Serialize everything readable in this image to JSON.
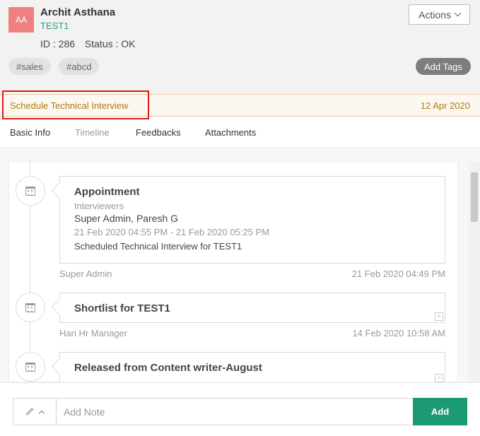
{
  "candidate": {
    "avatar_initials": "AA",
    "name": "Archit Asthana",
    "job": "TEST1",
    "id_text": "ID : 286",
    "status_text": "Status : OK"
  },
  "header": {
    "actions_label": "Actions",
    "tags": [
      "#sales",
      "#abcd"
    ],
    "add_tags_label": "Add Tags"
  },
  "stage": {
    "name": "Schedule Technical Interview",
    "date": "12 Apr 2020"
  },
  "tabs": [
    "Basic Info",
    "Timeline",
    "Feedbacks",
    "Attachments"
  ],
  "timeline": [
    {
      "title": "Appointment",
      "sub_label": "Interviewers",
      "interviewers": "Super Admin,  Paresh G",
      "time_range": "21 Feb 2020 04:55 PM - 21 Feb 2020 05:25 PM",
      "description": "Scheduled Technical Interview for TEST1",
      "author": "Super Admin",
      "timestamp": "21 Feb 2020 04:49 PM"
    },
    {
      "title": "Shortlist for TEST1",
      "author": "Hari Hr Manager",
      "timestamp": "14 Feb 2020 10:58 AM"
    },
    {
      "title": "Released from Content writer-August"
    }
  ],
  "note": {
    "placeholder": "Add Note",
    "add_label": "Add"
  },
  "colors": {
    "brand_green": "#1b9a74",
    "stage_text": "#b07a10",
    "avatar_bg": "#f08080",
    "highlight": "#e01818"
  }
}
